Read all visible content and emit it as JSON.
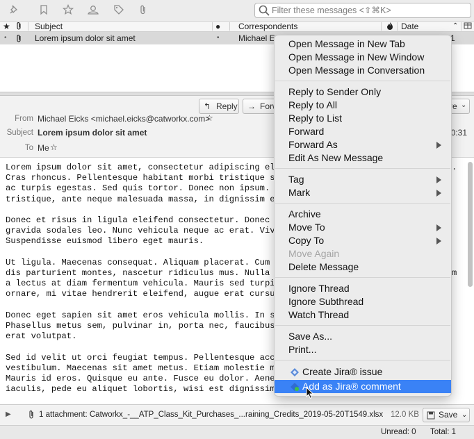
{
  "filter_bar": {
    "icons": [
      "pin-icon",
      "bookmark-icon",
      "star-icon",
      "contact-icon",
      "tag-icon",
      "paperclip-icon"
    ],
    "search_placeholder": "Filter these messages <⇧⌘K>"
  },
  "thread_pane": {
    "columns": [
      "Subject",
      "Correspondents",
      "Date"
    ],
    "rows": [
      {
        "subject": "Lorem ipsum dolor sit amet",
        "correspondent": "Michael E",
        "date": "1"
      }
    ]
  },
  "message_header": {
    "buttons": {
      "reply": "Reply",
      "forward": "Forw",
      "more": "re"
    },
    "from_label": "From",
    "from_value": "Michael Eicks <michael.eicks@catworkx.com>",
    "subject_label": "Subject",
    "subject_value": "Lorem ipsum dolor sit amet",
    "to_label": "To",
    "to_value": "Me",
    "time": "10:31"
  },
  "message_body": {
    "text": "Lorem ipsum dolor sit amet, consectetur adipiscing eli\nCras rhoncus. Pellentesque habitant morbi tristique se\nac turpis egestas. Sed quis tortor. Donec non ipsum. N\ntristique, ante neque malesuada massa, in dignissim er\n\nDonec et risus in ligula eleifend consectetur. Donec v\ngravida sodales leo. Nunc vehicula neque ac erat. Viva\nSuspendisse euismod libero eget mauris.\n\nUt ligula. Maecenas consequat. Aliquam placerat. Cum s\ndis parturient montes, nascetur ridiculus mus. Nulla c\na lectus at diam fermentum vehicula. Mauris sed turpis\nornare, mi vitae hendrerit eleifend, augue erat cursus\n\nDonec eget sapien sit amet eros vehicula mollis. In sc\nPhasellus metus sem, pulvinar in, porta nec, faucibus\nerat volutpat.\n\nSed id velit ut orci feugiat tempus. Pellentesque accu\nvestibulum. Maecenas sit amet metus. Etiam molestie ma\nMauris id eros. Quisque eu ante. Fusce eu dolor. Aenea\niaculis, pede eu aliquet lobortis, wisi est dignissim",
    "right_edge": [
      ".",
      "",
      "",
      "",
      "",
      "",
      "",
      "",
      "",
      "m",
      "",
      "",
      "",
      "",
      "",
      "",
      "",
      "",
      "",
      "",
      ""
    ]
  },
  "attachment_bar": {
    "label": "1 attachment: Catworkx_-__ATP_Class_Kit_Purchases_...raining_Credits_2019-05-20T1549.xlsx",
    "size": "12.0 KB",
    "save_label": "Save"
  },
  "status_bar": {
    "unread": "Unread: 0",
    "total": "Total: 1"
  },
  "context_menu": {
    "items": [
      {
        "label": "Open Message in New Tab"
      },
      {
        "label": "Open Message in New Window"
      },
      {
        "label": "Open Message in Conversation"
      },
      {
        "label": "Reply to Sender Only"
      },
      {
        "label": "Reply to All"
      },
      {
        "label": "Reply to List"
      },
      {
        "label": "Forward"
      },
      {
        "label": "Forward As"
      },
      {
        "label": "Edit As New Message"
      },
      {
        "label": "Tag"
      },
      {
        "label": "Mark"
      },
      {
        "label": "Archive"
      },
      {
        "label": "Move To"
      },
      {
        "label": "Copy To"
      },
      {
        "label": "Move Again"
      },
      {
        "label": "Delete Message"
      },
      {
        "label": "Ignore Thread"
      },
      {
        "label": "Ignore Subthread"
      },
      {
        "label": "Watch Thread"
      },
      {
        "label": "Save As..."
      },
      {
        "label": "Print..."
      },
      {
        "label": "Create Jira® issue"
      },
      {
        "label": "Add as Jira® comment"
      }
    ],
    "highlight_color": "#3a82f6"
  }
}
